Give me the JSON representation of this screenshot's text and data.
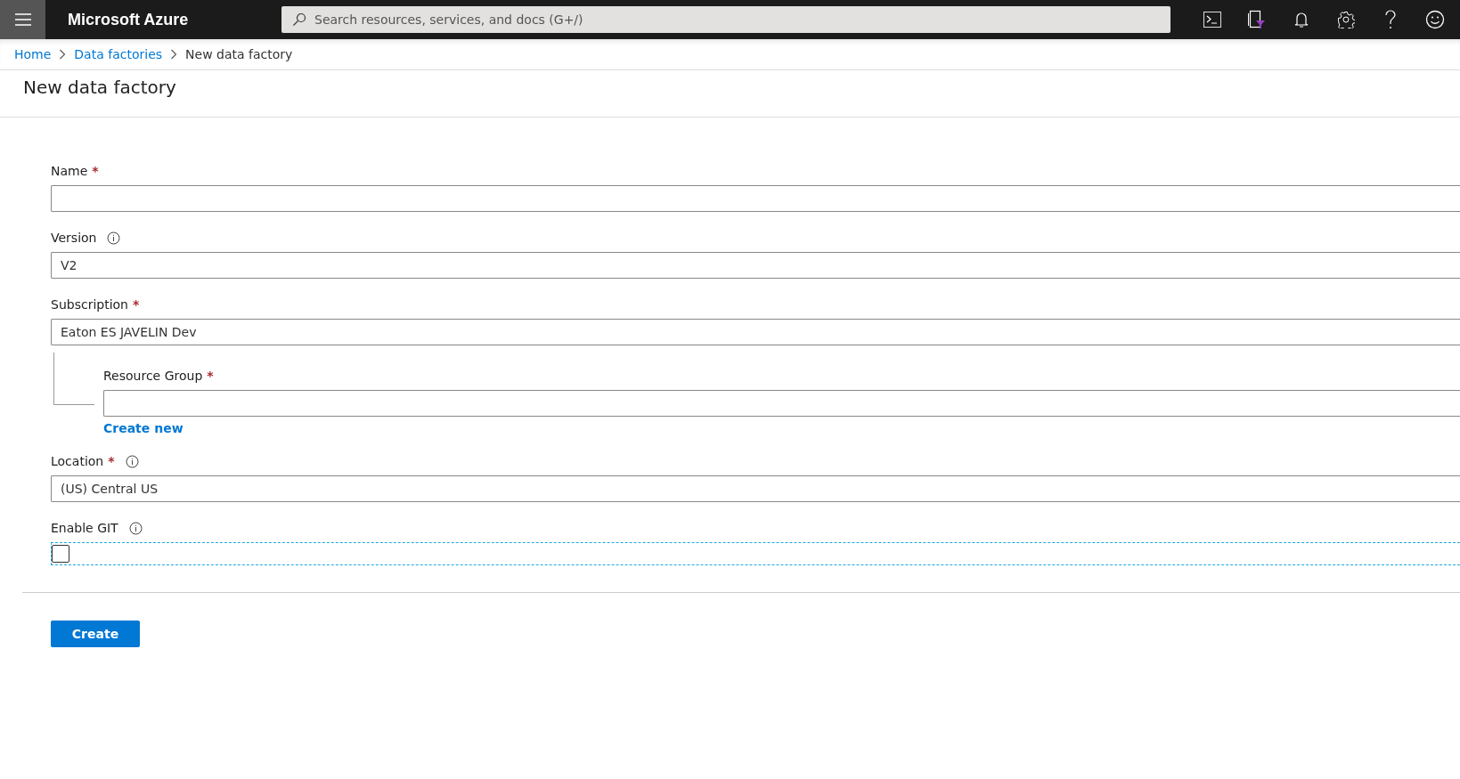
{
  "header": {
    "brand": "Microsoft Azure",
    "search": {
      "placeholder": "Search resources, services, and docs (G+/)"
    }
  },
  "breadcrumb": [
    {
      "label": "Home",
      "kind": "link"
    },
    {
      "label": "Data factories",
      "kind": "link"
    },
    {
      "label": "New data factory",
      "kind": "current"
    }
  ],
  "title": "New data factory",
  "fields": [
    {
      "kind": "text",
      "label": "Name",
      "required_mark": "*",
      "info": false
    },
    {
      "kind": "text",
      "label": "Version",
      "info": true,
      "value": "V2"
    },
    {
      "kind": "text",
      "label": "Subscription",
      "required_mark": "*",
      "info": false,
      "value": "Eaton ES JAVELIN Dev",
      "children": [
        {
          "kind": "text",
          "label": "Resource Group",
          "required_mark": "*",
          "info": false,
          "link": "Create new"
        }
      ]
    },
    {
      "kind": "text",
      "label": "Location",
      "required_mark": "*",
      "info": true,
      "value": "(US) Central US"
    },
    {
      "kind": "checkbox",
      "label": "Enable GIT",
      "info": true,
      "checked": false,
      "focused": true
    }
  ],
  "create_button": "Create"
}
